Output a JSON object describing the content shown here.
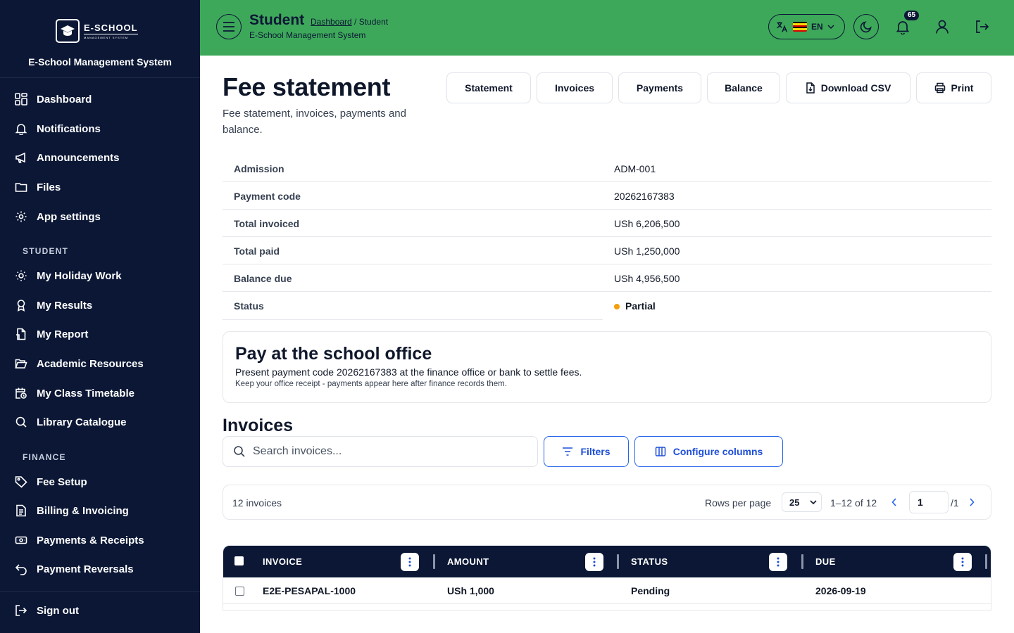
{
  "app": {
    "logo_text": "E-SCHOOL",
    "logo_sub": "MANAGEMENT SYSTEM",
    "system_name": "E-School Management System"
  },
  "sidebar": {
    "general_items": [
      {
        "label": "Dashboard",
        "icon": "dashboard-grid-icon"
      },
      {
        "label": "Notifications",
        "icon": "bell-icon"
      },
      {
        "label": "Announcements",
        "icon": "megaphone-icon"
      },
      {
        "label": "Files",
        "icon": "folder-icon"
      },
      {
        "label": "App settings",
        "icon": "gear-icon"
      }
    ],
    "student_section": "STUDENT",
    "student_items": [
      {
        "label": "My Holiday Work",
        "icon": "sun-icon"
      },
      {
        "label": "My Results",
        "icon": "award-icon"
      },
      {
        "label": "My Report",
        "icon": "report-icon"
      },
      {
        "label": "Academic Resources",
        "icon": "folder-open-icon"
      },
      {
        "label": "My Class Timetable",
        "icon": "calendar-clock-icon"
      },
      {
        "label": "Library Catalogue",
        "icon": "search-icon"
      }
    ],
    "finance_section": "FINANCE",
    "finance_items": [
      {
        "label": "Fee Setup",
        "icon": "tag-icon"
      },
      {
        "label": "Billing & Invoicing",
        "icon": "invoice-icon"
      },
      {
        "label": "Payments & Receipts",
        "icon": "banknote-icon"
      },
      {
        "label": "Payment Reversals",
        "icon": "undo-icon"
      }
    ],
    "sign_out": "Sign out"
  },
  "header": {
    "title": "Student",
    "breadcrumb_link": "Dashboard",
    "breadcrumb_current": " / Student",
    "subtitle": "E-School Management System",
    "language": "EN",
    "notification_count": "65",
    "bar_color": "#3ea85a"
  },
  "page": {
    "title": "Fee statement",
    "description": "Fee statement, invoices, payments and balance.",
    "actions": {
      "statement": "Statement",
      "invoices": "Invoices",
      "payments": "Payments",
      "balance": "Balance",
      "download_csv": "Download CSV",
      "print": "Print"
    }
  },
  "summary": [
    {
      "key": "Admission",
      "value": "ADM-001"
    },
    {
      "key": "Payment code",
      "value": "20262167383"
    },
    {
      "key": "Total invoiced",
      "value": "USh 6,206,500"
    },
    {
      "key": "Total paid",
      "value": "USh 1,250,000"
    },
    {
      "key": "Balance due",
      "value": "USh 4,956,500"
    },
    {
      "key": "Status",
      "value": "Partial"
    }
  ],
  "pay_card": {
    "title": "Pay at the school office",
    "line1": "Present payment code 20262167383 at the finance office or bank to settle fees.",
    "line2": "Keep your office receipt - payments appear here after finance records them."
  },
  "invoices": {
    "title": "Invoices",
    "search_placeholder": "Search invoices...",
    "filters_label": "Filters",
    "configure_label": "Configure columns",
    "count_text": "12 invoices",
    "rows_per_page_label": "Rows per page",
    "rows_per_page": "25",
    "range_text": "1–12 of 12",
    "page": "1",
    "page_total": "/1",
    "columns": [
      "INVOICE",
      "AMOUNT",
      "STATUS",
      "DUE"
    ],
    "rows": [
      {
        "invoice": "E2E-PESAPAL-1000",
        "amount": "USh 1,000",
        "status": "Pending",
        "due": "2026-09-19"
      }
    ]
  }
}
